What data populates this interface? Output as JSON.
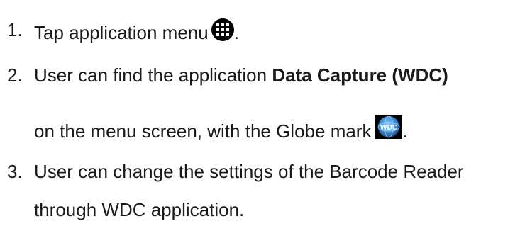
{
  "steps": [
    {
      "number": "1.",
      "text_before": "Tap application menu",
      "text_after": ".",
      "icon": "apps-grid-icon"
    },
    {
      "number": "2.",
      "text_before": "User can find the application",
      "bold": "Data Capture (WDC)",
      "line2_before": "on the menu screen, with the Globe mark",
      "line2_after": ".",
      "icon": "wdc-globe-icon",
      "icon_label": "WDC"
    },
    {
      "number": "3.",
      "text_line1": "User can change the settings of the Barcode Reader",
      "text_line2": "through WDC application."
    }
  ],
  "colors": {
    "text": "#1a1a1a",
    "icon_background": "#000000",
    "globe_blue": "#3a8fd6"
  }
}
